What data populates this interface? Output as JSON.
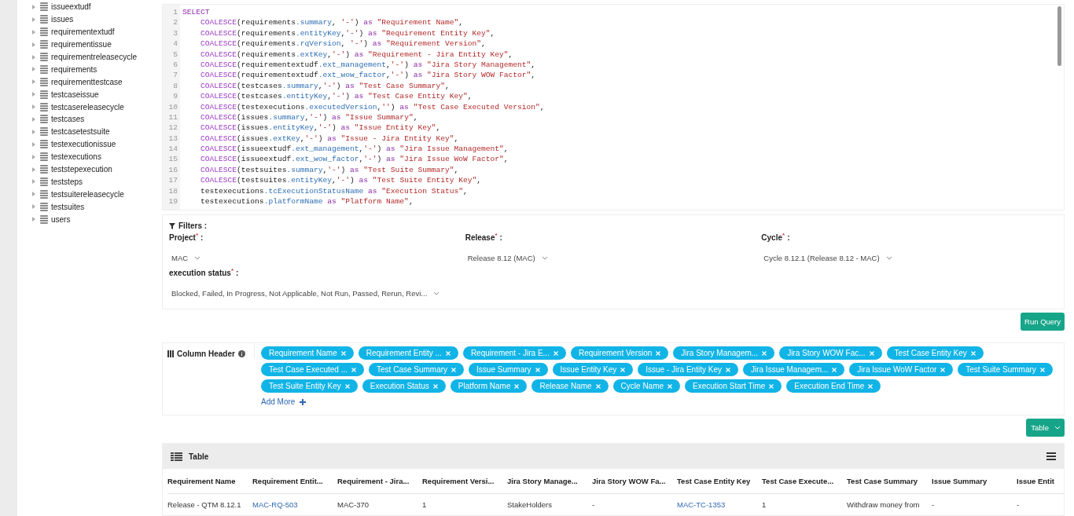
{
  "tree": {
    "items": [
      {
        "label": "issueextudf",
        "expanded": false
      },
      {
        "label": "issues",
        "expanded": false
      },
      {
        "label": "requirementextudf",
        "expanded": false
      },
      {
        "label": "requirementissue",
        "expanded": false
      },
      {
        "label": "requirementreleasecycle",
        "expanded": false
      },
      {
        "label": "requirements",
        "expanded": false
      },
      {
        "label": "requirementtestcase",
        "expanded": false
      },
      {
        "label": "testcaseissue",
        "expanded": false
      },
      {
        "label": "testcasereleasecycle",
        "expanded": false
      },
      {
        "label": "testcases",
        "expanded": false
      },
      {
        "label": "testcasetestsuite",
        "expanded": false
      },
      {
        "label": "testexecutionissue",
        "expanded": false
      },
      {
        "label": "testexecutions",
        "expanded": false
      },
      {
        "label": "teststepexecution",
        "expanded": false
      },
      {
        "label": "teststeps",
        "expanded": false
      },
      {
        "label": "testsuitereleasecycle",
        "expanded": false
      },
      {
        "label": "testsuites",
        "expanded": false
      },
      {
        "label": "users",
        "expanded": false
      }
    ]
  },
  "editor": {
    "lines": [
      {
        "number": "1",
        "indent": false,
        "segments": [
          {
            "kind": "kw",
            "text": "SELECT"
          }
        ]
      },
      {
        "number": "2",
        "indent": true,
        "segments": [
          {
            "kind": "fn",
            "text": "COALESCE"
          },
          {
            "kind": "p",
            "text": "(requirements"
          },
          {
            "kind": "prop",
            "text": ".summary"
          },
          {
            "kind": "p",
            "text": ", "
          },
          {
            "kind": "str",
            "text": "'-'"
          },
          {
            "kind": "p",
            "text": ") "
          },
          {
            "kind": "kw",
            "text": "as"
          },
          {
            "kind": "str",
            "text": " \"Requirement Name\""
          },
          {
            "kind": "p",
            "text": ","
          }
        ]
      },
      {
        "number": "3",
        "indent": true,
        "segments": [
          {
            "kind": "fn",
            "text": "COALESCE"
          },
          {
            "kind": "p",
            "text": "(requirements"
          },
          {
            "kind": "prop",
            "text": ".entityKey"
          },
          {
            "kind": "p",
            "text": ","
          },
          {
            "kind": "str",
            "text": "'-'"
          },
          {
            "kind": "p",
            "text": ") "
          },
          {
            "kind": "kw",
            "text": "as"
          },
          {
            "kind": "str",
            "text": " \"Requirement Entity Key\""
          },
          {
            "kind": "p",
            "text": ","
          }
        ]
      },
      {
        "number": "4",
        "indent": true,
        "segments": [
          {
            "kind": "fn",
            "text": "COALESCE"
          },
          {
            "kind": "p",
            "text": "(requirements"
          },
          {
            "kind": "prop",
            "text": ".rqVersion"
          },
          {
            "kind": "p",
            "text": ", "
          },
          {
            "kind": "str",
            "text": "'-'"
          },
          {
            "kind": "p",
            "text": ") "
          },
          {
            "kind": "kw",
            "text": "as"
          },
          {
            "kind": "str",
            "text": " \"Requirement Version\""
          },
          {
            "kind": "p",
            "text": ","
          }
        ]
      },
      {
        "number": "5",
        "indent": true,
        "segments": [
          {
            "kind": "fn",
            "text": "COALESCE"
          },
          {
            "kind": "p",
            "text": "(requirements"
          },
          {
            "kind": "prop",
            "text": ".extKey"
          },
          {
            "kind": "p",
            "text": ","
          },
          {
            "kind": "str",
            "text": "'-'"
          },
          {
            "kind": "p",
            "text": ") "
          },
          {
            "kind": "kw",
            "text": "as"
          },
          {
            "kind": "str",
            "text": " \"Requirement - Jira Entity Key\""
          },
          {
            "kind": "p",
            "text": ","
          }
        ]
      },
      {
        "number": "6",
        "indent": true,
        "segments": [
          {
            "kind": "fn",
            "text": "COALESCE"
          },
          {
            "kind": "p",
            "text": "(requirementextudf"
          },
          {
            "kind": "prop",
            "text": ".ext_management"
          },
          {
            "kind": "p",
            "text": ","
          },
          {
            "kind": "str",
            "text": "'-'"
          },
          {
            "kind": "p",
            "text": ") "
          },
          {
            "kind": "kw",
            "text": "as"
          },
          {
            "kind": "str",
            "text": " \"Jira Story Management\""
          },
          {
            "kind": "p",
            "text": ","
          }
        ]
      },
      {
        "number": "7",
        "indent": true,
        "segments": [
          {
            "kind": "fn",
            "text": "COALESCE"
          },
          {
            "kind": "p",
            "text": "(requirementextudf"
          },
          {
            "kind": "prop",
            "text": ".ext_wow_factor"
          },
          {
            "kind": "p",
            "text": ","
          },
          {
            "kind": "str",
            "text": "'-'"
          },
          {
            "kind": "p",
            "text": ") "
          },
          {
            "kind": "kw",
            "text": "as"
          },
          {
            "kind": "str",
            "text": " \"Jira Story WOW Factor\""
          },
          {
            "kind": "p",
            "text": ","
          }
        ]
      },
      {
        "number": "8",
        "indent": true,
        "segments": [
          {
            "kind": "fn",
            "text": "COALESCE"
          },
          {
            "kind": "p",
            "text": "(testcases"
          },
          {
            "kind": "prop",
            "text": ".summary"
          },
          {
            "kind": "p",
            "text": ","
          },
          {
            "kind": "str",
            "text": "'-'"
          },
          {
            "kind": "p",
            "text": ") "
          },
          {
            "kind": "kw",
            "text": "as"
          },
          {
            "kind": "str",
            "text": " \"Test Case Summary\""
          },
          {
            "kind": "p",
            "text": ","
          }
        ]
      },
      {
        "number": "9",
        "indent": true,
        "segments": [
          {
            "kind": "fn",
            "text": "COALESCE"
          },
          {
            "kind": "p",
            "text": "(testcases"
          },
          {
            "kind": "prop",
            "text": ".entityKey"
          },
          {
            "kind": "p",
            "text": ","
          },
          {
            "kind": "str",
            "text": "'-'"
          },
          {
            "kind": "p",
            "text": ") "
          },
          {
            "kind": "kw",
            "text": "as"
          },
          {
            "kind": "str",
            "text": " \"Test Case Entity Key\""
          },
          {
            "kind": "p",
            "text": ","
          }
        ]
      },
      {
        "number": "10",
        "indent": true,
        "segments": [
          {
            "kind": "fn",
            "text": "COALESCE"
          },
          {
            "kind": "p",
            "text": "(testexecutions"
          },
          {
            "kind": "prop",
            "text": ".executedVersion"
          },
          {
            "kind": "p",
            "text": ","
          },
          {
            "kind": "str",
            "text": "''"
          },
          {
            "kind": "p",
            "text": ") "
          },
          {
            "kind": "kw",
            "text": "as"
          },
          {
            "kind": "str",
            "text": " \"Test Case Executed Version\""
          },
          {
            "kind": "p",
            "text": ","
          }
        ]
      },
      {
        "number": "11",
        "indent": true,
        "segments": [
          {
            "kind": "fn",
            "text": "COALESCE"
          },
          {
            "kind": "p",
            "text": "(issues"
          },
          {
            "kind": "prop",
            "text": ".summary"
          },
          {
            "kind": "p",
            "text": ","
          },
          {
            "kind": "str",
            "text": "'-'"
          },
          {
            "kind": "p",
            "text": ") "
          },
          {
            "kind": "kw",
            "text": "as"
          },
          {
            "kind": "str",
            "text": " \"Issue Summary\""
          },
          {
            "kind": "p",
            "text": ","
          }
        ]
      },
      {
        "number": "12",
        "indent": true,
        "segments": [
          {
            "kind": "fn",
            "text": "COALESCE"
          },
          {
            "kind": "p",
            "text": "(issues"
          },
          {
            "kind": "prop",
            "text": ".entityKey"
          },
          {
            "kind": "p",
            "text": ","
          },
          {
            "kind": "str",
            "text": "'-'"
          },
          {
            "kind": "p",
            "text": ") "
          },
          {
            "kind": "kw",
            "text": "as"
          },
          {
            "kind": "str",
            "text": " \"Issue Entity Key\""
          },
          {
            "kind": "p",
            "text": ","
          }
        ]
      },
      {
        "number": "13",
        "indent": true,
        "segments": [
          {
            "kind": "fn",
            "text": "COALESCE"
          },
          {
            "kind": "p",
            "text": "(issues"
          },
          {
            "kind": "prop",
            "text": ".extKey"
          },
          {
            "kind": "p",
            "text": ","
          },
          {
            "kind": "str",
            "text": "'-'"
          },
          {
            "kind": "p",
            "text": ") "
          },
          {
            "kind": "kw",
            "text": "as"
          },
          {
            "kind": "str",
            "text": " \"Issue - Jira Entity Key\""
          },
          {
            "kind": "p",
            "text": ","
          }
        ]
      },
      {
        "number": "14",
        "indent": true,
        "segments": [
          {
            "kind": "fn",
            "text": "COALESCE"
          },
          {
            "kind": "p",
            "text": "(issueextudf"
          },
          {
            "kind": "prop",
            "text": ".ext_management"
          },
          {
            "kind": "p",
            "text": ","
          },
          {
            "kind": "str",
            "text": "'-'"
          },
          {
            "kind": "p",
            "text": ") "
          },
          {
            "kind": "kw",
            "text": "as"
          },
          {
            "kind": "str",
            "text": " \"Jira Issue Management\""
          },
          {
            "kind": "p",
            "text": ","
          }
        ]
      },
      {
        "number": "15",
        "indent": true,
        "segments": [
          {
            "kind": "fn",
            "text": "COALESCE"
          },
          {
            "kind": "p",
            "text": "(issueextudf"
          },
          {
            "kind": "prop",
            "text": ".ext_wow_factor"
          },
          {
            "kind": "p",
            "text": ","
          },
          {
            "kind": "str",
            "text": "'-'"
          },
          {
            "kind": "p",
            "text": ") "
          },
          {
            "kind": "kw",
            "text": "as"
          },
          {
            "kind": "str",
            "text": " \"Jira Issue WoW Factor\""
          },
          {
            "kind": "p",
            "text": ","
          }
        ]
      },
      {
        "number": "16",
        "indent": true,
        "segments": [
          {
            "kind": "fn",
            "text": "COALESCE"
          },
          {
            "kind": "p",
            "text": "(testsuites"
          },
          {
            "kind": "prop",
            "text": ".summary"
          },
          {
            "kind": "p",
            "text": ","
          },
          {
            "kind": "str",
            "text": "'-'"
          },
          {
            "kind": "p",
            "text": ") "
          },
          {
            "kind": "kw",
            "text": "as"
          },
          {
            "kind": "str",
            "text": " \"Test Suite Summary\""
          },
          {
            "kind": "p",
            "text": ","
          }
        ]
      },
      {
        "number": "17",
        "indent": true,
        "segments": [
          {
            "kind": "fn",
            "text": "COALESCE"
          },
          {
            "kind": "p",
            "text": "(testsuites"
          },
          {
            "kind": "prop",
            "text": ".entityKey"
          },
          {
            "kind": "p",
            "text": ","
          },
          {
            "kind": "str",
            "text": "'-'"
          },
          {
            "kind": "p",
            "text": ") "
          },
          {
            "kind": "kw",
            "text": "as"
          },
          {
            "kind": "str",
            "text": " \"Test Suite Entity Key\""
          },
          {
            "kind": "p",
            "text": ","
          }
        ]
      },
      {
        "number": "18",
        "indent": true,
        "segments": [
          {
            "kind": "p",
            "text": "testexecutions"
          },
          {
            "kind": "prop",
            "text": ".tcExecutionStatusName"
          },
          {
            "kind": "kw",
            "text": " as"
          },
          {
            "kind": "str",
            "text": " \"Execution Status\""
          },
          {
            "kind": "p",
            "text": ","
          }
        ]
      },
      {
        "number": "19",
        "indent": true,
        "segments": [
          {
            "kind": "p",
            "text": "testexecutions"
          },
          {
            "kind": "prop",
            "text": ".platformName"
          },
          {
            "kind": "kw",
            "text": " as"
          },
          {
            "kind": "str",
            "text": " \"Platform Name\""
          },
          {
            "kind": "p",
            "text": ","
          }
        ]
      }
    ]
  },
  "filters": {
    "title": "Filters :",
    "fields": [
      {
        "label": "Project",
        "required": true,
        "mark": "*",
        "separator": ":",
        "value": "MAC"
      },
      {
        "label": "Release",
        "required": true,
        "mark": "*",
        "separator": ":",
        "value": "Release 8.12 (MAC)"
      },
      {
        "label": "Cycle",
        "required": true,
        "mark": "*",
        "separator": ":",
        "value": "Cycle 8.12.1 (Release 8.12 - MAC)"
      },
      {
        "label": "execution status",
        "required": true,
        "mark": "*",
        "separator": ":",
        "value": "Blocked, Failed, In Progress, Not Applicable, Not Run, Passed, Rerun, Revi..."
      }
    ],
    "run_button": "Run Query"
  },
  "column_header": {
    "title": "Column Header",
    "tags": [
      "Requirement Name",
      "Requirement Entity ...",
      "Requirement - Jira E...",
      "Requirement Version",
      "Jira Story Managem...",
      "Jira Story WOW Fac...",
      "Test Case Entity Key",
      "Test Case Executed ...",
      "Test Case Summary",
      "Issue Summary",
      "Issue Entity Key",
      "Issue - Jira Entity Key",
      "Jira Issue Managem...",
      "Jira Issue WoW Factor",
      "Test Suite Summary",
      "Test Suite Entity Key",
      "Execution Status",
      "Platform Name",
      "Release Name",
      "Cycle Name",
      "Execution Start Time",
      "Execution End Time"
    ],
    "add_more": "Add More"
  },
  "view_select": {
    "value": "Table"
  },
  "table": {
    "title": "Table",
    "columns": [
      "Requirement Name",
      "Requirement Entit...",
      "Requirement - Jira...",
      "Requirement Versi...",
      "Jira Story Manage...",
      "Jira Story WOW Fa...",
      "Test Case Entity Key",
      "Test Case Execute...",
      "Test Case Summary",
      "Issue Summary",
      "Issue Entit"
    ],
    "rows": [
      [
        {
          "text": "Release - QTM 8.12.1",
          "link": false
        },
        {
          "text": "MAC-RQ-503",
          "link": true
        },
        {
          "text": "MAC-370",
          "link": false
        },
        {
          "text": "1",
          "link": false
        },
        {
          "text": "StakeHolders",
          "link": false
        },
        {
          "text": "-",
          "link": false
        },
        {
          "text": "MAC-TC-1353",
          "link": true
        },
        {
          "text": "1",
          "link": false
        },
        {
          "text": "Withdraw money from",
          "link": false
        },
        {
          "text": "-",
          "link": false
        },
        {
          "text": "-",
          "link": false
        }
      ]
    ]
  }
}
